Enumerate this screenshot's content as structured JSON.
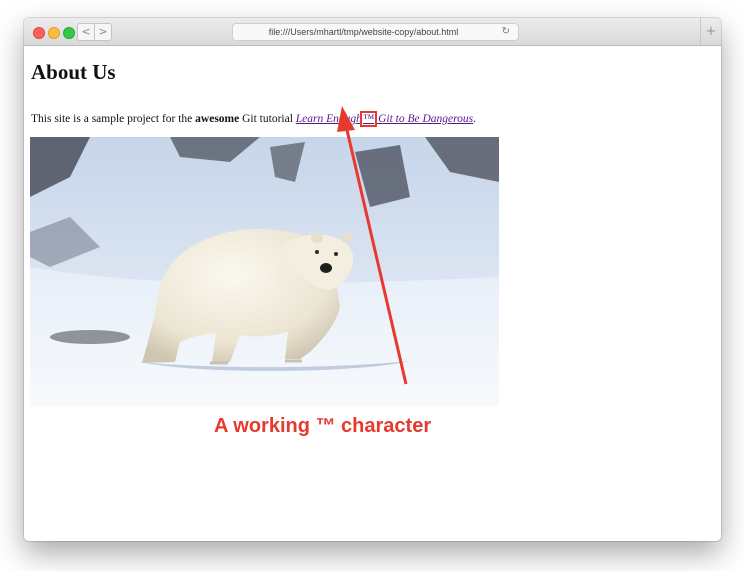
{
  "browser": {
    "url": "file:///Users/mhartl/tmp/website-copy/about.html",
    "back_icon": "<",
    "forward_icon": ">",
    "reload_icon": "↻",
    "new_tab_icon": "+"
  },
  "page": {
    "heading": "About Us",
    "intro_prefix": "This site is a sample project for the ",
    "intro_bold": "awesome",
    "intro_middle": " Git tutorial ",
    "link_part1": "Learn Enough",
    "trademark": "™",
    "link_part2": " Git to Be Dangerous",
    "intro_suffix": ".",
    "image_subject": "polar-bear"
  },
  "annotation": {
    "text": "A working ™ character",
    "color": "#e8392f"
  }
}
